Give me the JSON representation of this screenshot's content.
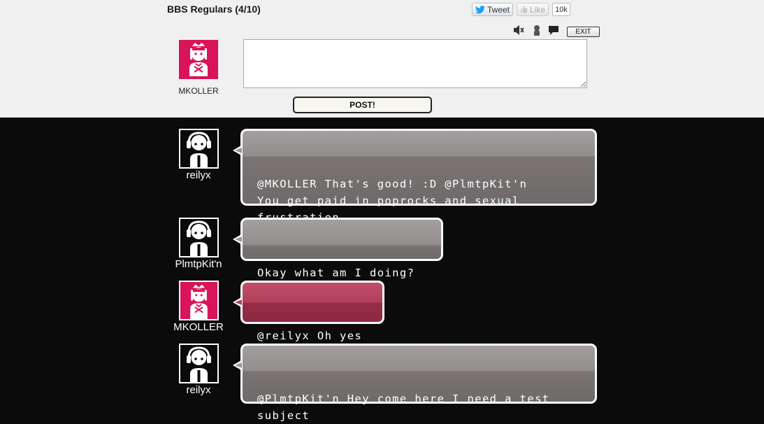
{
  "colors": {
    "header_bg": "#f0f0f0",
    "chat_bg": "#0b0b0b",
    "bubble_gray": "#8a8484",
    "bubble_pink": "#a33550",
    "avatar_pink": "#d8145a",
    "twitter_blue": "#1da1f2"
  },
  "header": {
    "room_title": "BBS Regulars (4/10)",
    "tweet_label": "Tweet",
    "tweet_icon": "twitter-bird-icon",
    "like_label": "Like",
    "like_icon": "thumbs-up-icon",
    "like_count": "10k",
    "controls": {
      "sound_icon": "speaker-muted-icon",
      "users_icon": "user-silhouette-icon",
      "chat_icon": "speech-bubble-icon",
      "exit_label": "EXIT"
    }
  },
  "composer": {
    "username": "MKOLLER",
    "avatar_icon": "maid-avatar-icon",
    "input_value": "",
    "post_label": "POST!"
  },
  "messages": [
    {
      "user": "reilyx",
      "avatar_icon": "headphones-avatar-icon",
      "text": "@MKOLLER That's good! :D @PlmtpKit'n\nYou get paid in poprocks and sexual\nfrustration"
    },
    {
      "user": "PlmtpKit'n",
      "avatar_icon": "headphones-avatar-icon",
      "text": "Okay what am I doing?"
    },
    {
      "user": "MKOLLER",
      "avatar_icon": "maid-avatar-icon",
      "text": "@reilyx Oh yes"
    },
    {
      "user": "reilyx",
      "avatar_icon": "headphones-avatar-icon",
      "text": "@PlmtpKit'n Hey come here I need a test\nsubject"
    }
  ]
}
